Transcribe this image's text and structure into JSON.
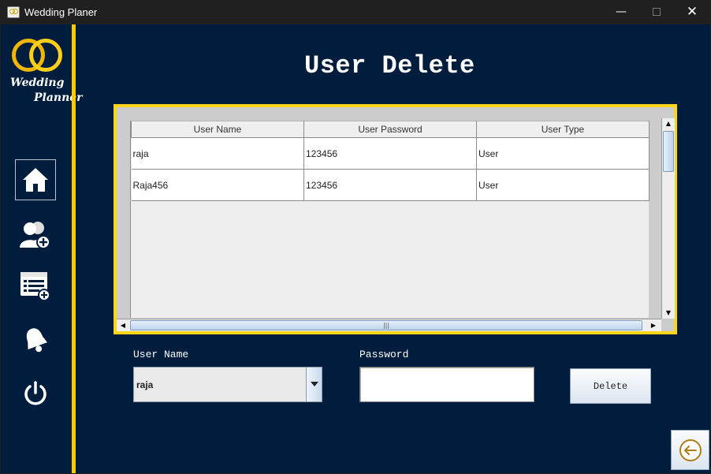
{
  "window": {
    "title": "Wedding Planer",
    "minimize_glyph": "—",
    "close_glyph": "✕"
  },
  "logo": {
    "line1": "Wedding",
    "line2": "Planner"
  },
  "sidebar": {
    "items": [
      {
        "icon": "home-icon",
        "active": true
      },
      {
        "icon": "add-user-icon"
      },
      {
        "icon": "add-list-icon"
      },
      {
        "icon": "bell-icon"
      },
      {
        "icon": "power-icon"
      }
    ]
  },
  "page": {
    "title": "User Delete"
  },
  "table": {
    "columns": [
      "User Name",
      "User Password",
      "User Type"
    ],
    "rows": [
      [
        "raja",
        "123456",
        "User"
      ],
      [
        "Raja456",
        "123456",
        "User"
      ]
    ]
  },
  "form": {
    "user_name_label": "User Name",
    "user_name_value": "raja",
    "password_label": "Password",
    "password_value": "",
    "delete_label": "Delete"
  },
  "colors": {
    "background": "#001d3d",
    "accent": "#ffc800",
    "titlebar": "#202020"
  }
}
